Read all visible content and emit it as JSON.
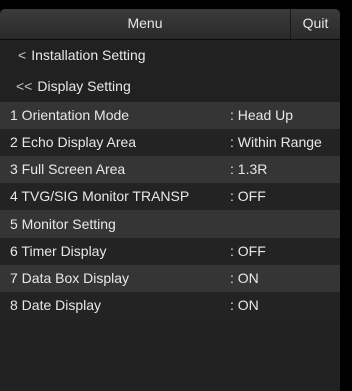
{
  "titlebar": {
    "menu_label": "Menu",
    "quit_label": "Quit"
  },
  "nav": {
    "installation": {
      "chevron": "<",
      "label": "Installation Setting"
    },
    "display": {
      "chevron": "<<",
      "label": "Display Setting"
    }
  },
  "items": [
    {
      "label": "1 Orientation Mode",
      "value": ": Head Up"
    },
    {
      "label": "2 Echo Display Area",
      "value": ": Within Range"
    },
    {
      "label": "3 Full Screen Area",
      "value": ": 1.3R"
    },
    {
      "label": "4 TVG/SIG Monitor TRANSP",
      "value": ": OFF"
    },
    {
      "label": "5 Monitor Setting",
      "value": ""
    },
    {
      "label": "6 Timer Display",
      "value": ": OFF"
    },
    {
      "label": "7 Data Box Display",
      "value": ": ON"
    },
    {
      "label": "8 Date Display",
      "value": ": ON"
    }
  ]
}
